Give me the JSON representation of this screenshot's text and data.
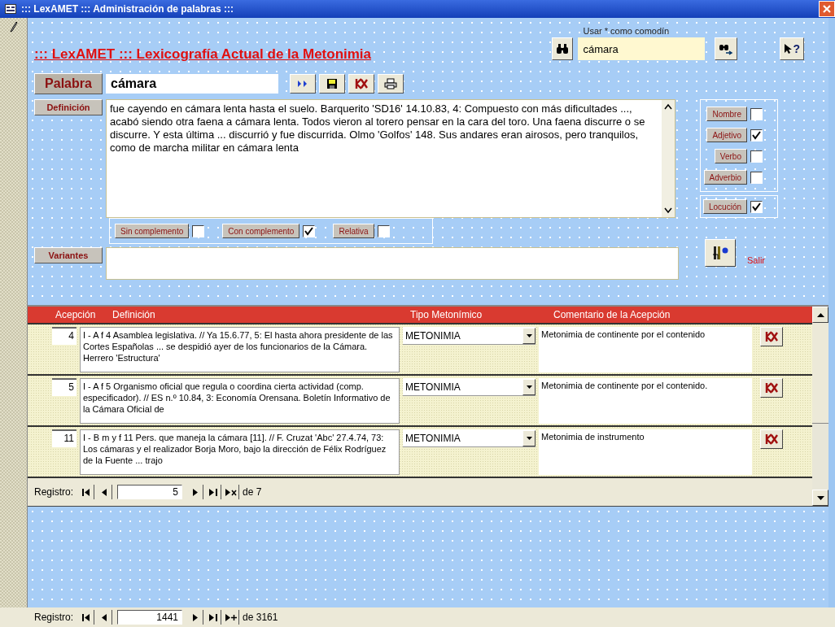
{
  "window": {
    "title": "::: LexAMET ::: Administración de palabras :::"
  },
  "heading": "::: LexAMET :::  Lexicografía Actual de la Metonimia",
  "search": {
    "hint": "Usar * como comodín",
    "value": "cámara",
    "help": "?"
  },
  "word": {
    "label": "Palabra",
    "value": "cámara"
  },
  "definition": {
    "label": "Definición",
    "value": "fue cayendo en cámara lenta hasta el suelo. Barquerito 'SD16' 14.10.83, 4: Compuesto con más dificultades ..., acabó siendo otra faena a cámara lenta. Todos vieron al torero pensar en la cara del toro. Una faena discurre o se discurre. Y esta última ... discurrió y fue discurrida. Olmo 'Golfos' 148. Sus andares eran airosos, pero tranquilos, como de marcha militar en cámara lenta"
  },
  "complement_options": [
    {
      "label": "Sin complemento",
      "checked": false
    },
    {
      "label": "Con complemento",
      "checked": true
    },
    {
      "label": "Relativa",
      "checked": false
    }
  ],
  "part_of_speech": [
    {
      "label": "Nombre",
      "checked": false
    },
    {
      "label": "Adjetivo",
      "checked": true
    },
    {
      "label": "Verbo",
      "checked": false
    },
    {
      "label": "Adverbio",
      "checked": false
    }
  ],
  "locution": {
    "label": "Locución",
    "checked": true
  },
  "variants": {
    "label": "Variantes"
  },
  "exit": {
    "label": "Salir"
  },
  "senses": {
    "columns": [
      "Acepción",
      "Definición",
      "Tipo Metonímico",
      "Comentario de la Acepción"
    ],
    "rows": [
      {
        "number": "4",
        "definition": "I - A f 4 Asamblea legislativa. // Ya 15.6.77, 5: El hasta ahora presidente de las Cortes Españolas ... se despidió ayer de los funcionarios de la Cámara. Herrero 'Estructura'",
        "type": "METONIMIA",
        "comment": "Metonimia de continente por el contenido"
      },
      {
        "number": "5",
        "definition": "I - A f 5 Organismo oficial que regula o coordina cierta actividad (comp. especificador). // ES n.º 10.84, 3: Economía Orensana. Boletín Informativo de la Cámara Oficial de",
        "type": "METONIMIA",
        "comment": "Metonimia de continente por el contenido."
      },
      {
        "number": "11",
        "definition": "I - B m y f 11 Pers. que maneja la cámara [11]. // F. Cruzat 'Abc' 27.4.74, 73: Los cámaras y el realizador Borja Moro, bajo la dirección de Félix Rodríguez de la Fuente ... trajo",
        "type": "METONIMIA",
        "comment": "Metonimia de instrumento"
      }
    ],
    "navigator": {
      "label": "Registro:",
      "current": "5",
      "total": "de 7"
    }
  },
  "navigator": {
    "label": "Registro:",
    "current": "1441",
    "total": "de 3161"
  }
}
